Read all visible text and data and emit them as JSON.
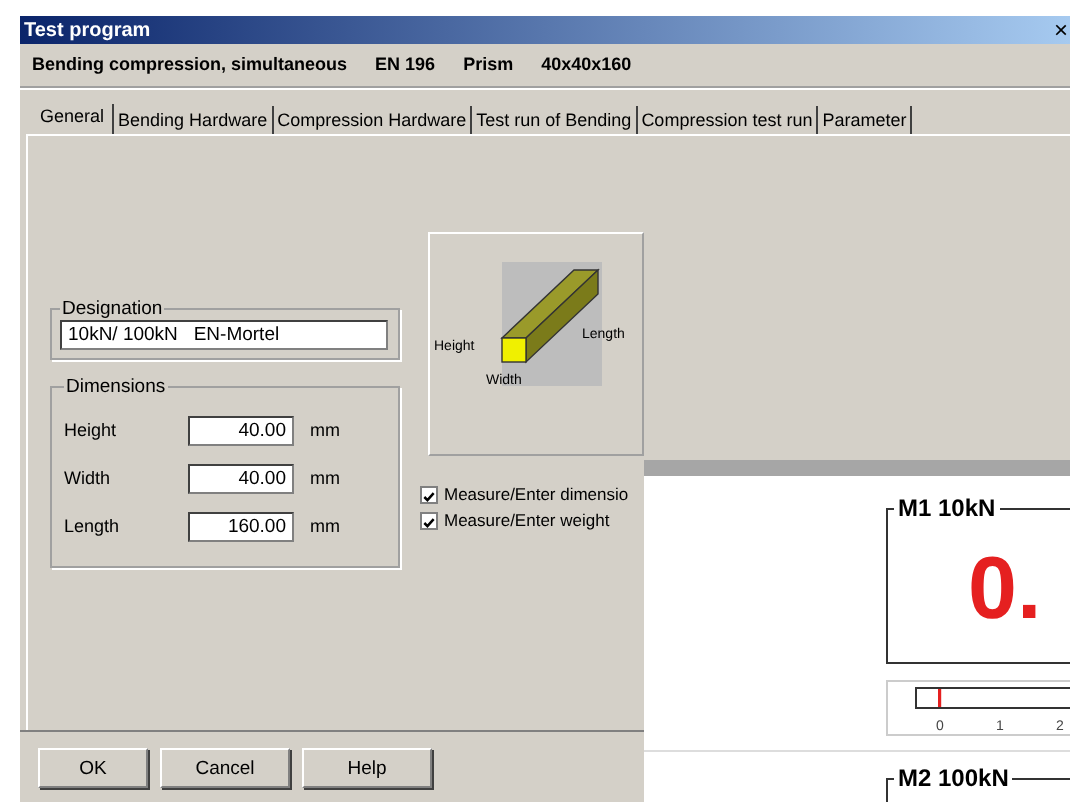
{
  "window": {
    "title": "Test program",
    "close": "×"
  },
  "header": [
    "Bending compression, simultaneous",
    "EN 196",
    "Prism",
    "40x40x160"
  ],
  "tabs": [
    {
      "label": "General",
      "selected": true
    },
    {
      "label": "Bending Hardware",
      "selected": false
    },
    {
      "label": "Compression Hardware",
      "selected": false
    },
    {
      "label": "Test run of Bending",
      "selected": false
    },
    {
      "label": "Compression test run",
      "selected": false
    },
    {
      "label": "Parameter",
      "selected": false
    }
  ],
  "designation": {
    "label": "Designation",
    "value": "10kN/ 100kN   EN-Mortel"
  },
  "dimensions": {
    "label": "Dimensions",
    "fields": [
      {
        "label": "Height",
        "value": "40.00",
        "unit": "mm"
      },
      {
        "label": "Width",
        "value": "40.00",
        "unit": "mm"
      },
      {
        "label": "Length",
        "value": "160.00",
        "unit": "mm"
      }
    ]
  },
  "diagram": {
    "height": "Height",
    "width": "Width",
    "length": "Length"
  },
  "checkboxes": [
    {
      "label": "Measure/Enter dimensio",
      "checked": true
    },
    {
      "label": "Measure/Enter weight",
      "checked": true
    }
  ],
  "buttons": [
    "OK",
    "Cancel",
    "Help"
  ],
  "meter_window": {
    "panels": [
      {
        "title": "M1 10kN",
        "value": "0."
      },
      {
        "title": "M2 100kN"
      }
    ],
    "scale": {
      "ticks": [
        "0",
        "1",
        "2"
      ]
    }
  }
}
